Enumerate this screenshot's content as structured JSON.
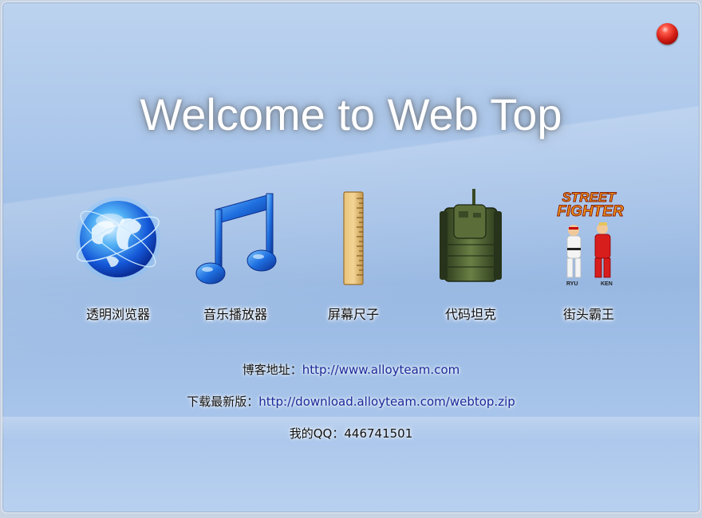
{
  "window": {
    "title": "Welcome to Web Top"
  },
  "apps": [
    {
      "label": "透明浏览器",
      "icon": "globe-icon"
    },
    {
      "label": "音乐播放器",
      "icon": "music-note-icon"
    },
    {
      "label": "屏幕尺子",
      "icon": "ruler-icon"
    },
    {
      "label": "代码坦克",
      "icon": "tank-icon"
    },
    {
      "label": "街头霸王",
      "icon": "street-fighter-icon"
    }
  ],
  "street_fighter_icon_text": {
    "line1": "STREET",
    "line2": "FIGHTER",
    "ryu": "RYU",
    "ken": "KEN"
  },
  "info": {
    "blog_label": "博客地址：",
    "blog_url": "http://www.alloyteam.com",
    "download_label": "下载最新版：",
    "download_url": "http://download.alloyteam.com/webtop.zip",
    "qq_label": "我的QQ：",
    "qq_number": "446741501"
  },
  "colors": {
    "link": "#1a2a9a",
    "close_button": "#d01a12",
    "background": "#a9c5ea"
  }
}
